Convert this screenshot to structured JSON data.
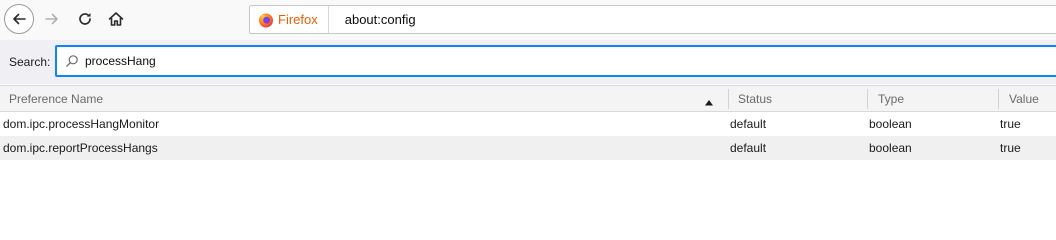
{
  "browser": {
    "identity_label": "Firefox",
    "url": "about:config",
    "icons": {
      "back": "arrow-left-icon",
      "forward": "arrow-right-icon",
      "reload": "reload-icon",
      "home": "home-icon",
      "identity": "firefox-logo-icon"
    }
  },
  "search": {
    "label": "Search:",
    "value": "processHang",
    "icon": "search-icon",
    "focus_color": "#0a84ff"
  },
  "table": {
    "columns": [
      "Preference Name",
      "Status",
      "Type",
      "Value"
    ],
    "sort": {
      "column": "Preference Name",
      "direction": "ascending"
    },
    "rows": [
      {
        "name": "dom.ipc.processHangMonitor",
        "status": "default",
        "type": "boolean",
        "value": "true"
      },
      {
        "name": "dom.ipc.reportProcessHangs",
        "status": "default",
        "type": "boolean",
        "value": "true"
      }
    ]
  },
  "colors": {
    "identity": "#e66000",
    "focus": "#0a84ff"
  }
}
